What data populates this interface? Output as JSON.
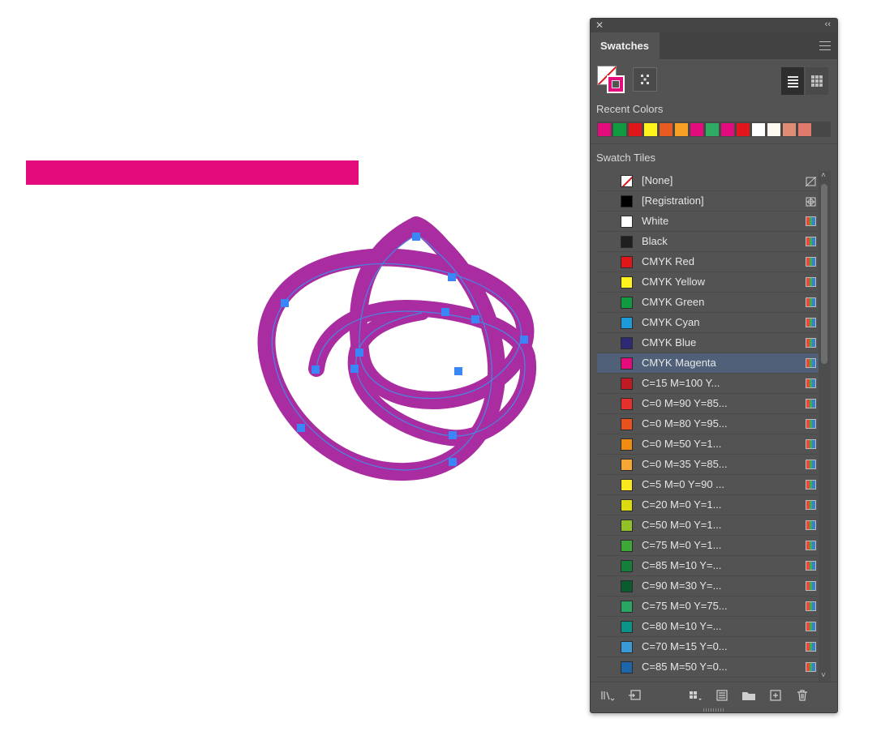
{
  "canvas": {
    "bar_color": "#e40c7c",
    "path_fill": "#a92da0",
    "path_line": "#4a84e2",
    "anchor_color": "#3b86f6"
  },
  "panel": {
    "tab_label": "Swatches",
    "close_icon": "close-icon",
    "collapse_icon": "collapse-icon",
    "recent_colors_label": "Recent Colors",
    "swatch_tiles_label": "Swatch Tiles",
    "list_view_icon": "list-view-icon",
    "grid_view_icon": "grid-view-icon"
  },
  "recent_colors": [
    "#e40c7c",
    "#119a3f",
    "#e0161b",
    "#fff21d",
    "#ea5b21",
    "#f8a025",
    "#e40c7c",
    "#2eaa62",
    "#e40c7c",
    "#e0161b",
    "#ffffff",
    "#fffaf2",
    "#de8c74",
    "#e0786c"
  ],
  "swatches": [
    {
      "name": "[None]",
      "color": "none",
      "type": "none-icon"
    },
    {
      "name": "[Registration]",
      "color": "#000000",
      "type": "registration-icon"
    },
    {
      "name": "White",
      "color": "#ffffff",
      "type": "cmyk-icon"
    },
    {
      "name": "Black",
      "color": "#1f1f1f",
      "type": "cmyk-icon"
    },
    {
      "name": "CMYK Red",
      "color": "#e0161b",
      "type": "cmyk-icon"
    },
    {
      "name": "CMYK Yellow",
      "color": "#fff21d",
      "type": "cmyk-icon"
    },
    {
      "name": "CMYK Green",
      "color": "#119a3f",
      "type": "cmyk-icon"
    },
    {
      "name": "CMYK Cyan",
      "color": "#1e9ad7",
      "type": "cmyk-icon"
    },
    {
      "name": "CMYK Blue",
      "color": "#2c2a74",
      "type": "cmyk-icon"
    },
    {
      "name": "CMYK Magenta",
      "color": "#e40c7c",
      "type": "cmyk-icon",
      "selected": true
    },
    {
      "name": "C=15 M=100 Y...",
      "color": "#c01b25",
      "type": "cmyk-icon"
    },
    {
      "name": "C=0 M=90 Y=85...",
      "color": "#e4312b",
      "type": "cmyk-icon"
    },
    {
      "name": "C=0 M=80 Y=95...",
      "color": "#e7521e",
      "type": "cmyk-icon"
    },
    {
      "name": "C=0 M=50 Y=1...",
      "color": "#ef8c12",
      "type": "cmyk-icon"
    },
    {
      "name": "C=0 M=35 Y=85...",
      "color": "#f6a736",
      "type": "cmyk-icon"
    },
    {
      "name": "C=5 M=0 Y=90 ...",
      "color": "#fbe720",
      "type": "cmyk-icon"
    },
    {
      "name": "C=20 M=0 Y=1...",
      "color": "#dcdb12",
      "type": "cmyk-icon"
    },
    {
      "name": "C=50 M=0 Y=1...",
      "color": "#92c028",
      "type": "cmyk-icon"
    },
    {
      "name": "C=75 M=0 Y=1...",
      "color": "#3da737",
      "type": "cmyk-icon"
    },
    {
      "name": "C=85 M=10 Y=...",
      "color": "#137f3b",
      "type": "cmyk-icon"
    },
    {
      "name": "C=90 M=30 Y=...",
      "color": "#0a5c2e",
      "type": "cmyk-icon"
    },
    {
      "name": "C=75 M=0 Y=75...",
      "color": "#2aa664",
      "type": "cmyk-icon"
    },
    {
      "name": "C=80 M=10 Y=...",
      "color": "#0b9387",
      "type": "cmyk-icon"
    },
    {
      "name": "C=70 M=15 Y=0...",
      "color": "#3a9ad5",
      "type": "cmyk-icon"
    },
    {
      "name": "C=85 M=50 Y=0...",
      "color": "#1c66a9",
      "type": "cmyk-icon"
    }
  ],
  "bottom_toolbar": [
    {
      "name": "swatch-libraries-menu-icon"
    },
    {
      "name": "place-swatch-exchange-icon"
    },
    {
      "name": "show-swatch-kinds-menu-icon"
    },
    {
      "name": "swatch-options-icon"
    },
    {
      "name": "new-color-group-icon"
    },
    {
      "name": "new-swatch-icon"
    },
    {
      "name": "delete-swatch-icon"
    }
  ]
}
